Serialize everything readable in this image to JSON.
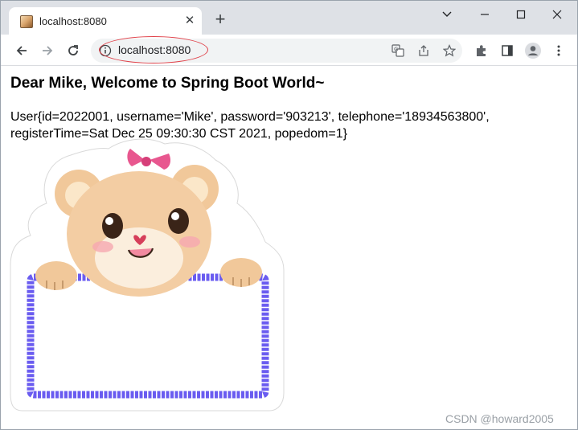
{
  "tab": {
    "title": "localhost:8080",
    "close_label": "✕",
    "new_tab_label": "+"
  },
  "omnibox": {
    "url": "localhost:8080",
    "highlight_color": "#e0424a"
  },
  "page": {
    "greeting": "Dear Mike, Welcome to Spring Boot World~",
    "user_info": "User{id=2022001, username='Mike', password='903213', telephone='18934563800', registerTime=Sat Dec 25 09:30:30 CST 2021, popedom=1}"
  },
  "watermark": "CSDN @howard2005",
  "icons": {
    "favicon": "bear-favicon",
    "back": "back-arrow-icon",
    "forward": "forward-arrow-icon",
    "reload": "reload-icon",
    "info": "info-icon",
    "translate": "translate-icon",
    "share": "share-icon",
    "bookmark": "star-icon",
    "extensions": "puzzle-icon",
    "side_panel": "side-panel-icon",
    "profile": "profile-icon",
    "menu": "kebab-menu-icon"
  },
  "colors": {
    "frame": "#dee1e6",
    "omnibox_bg": "#f1f3f4",
    "board_border": "#6a5cf0",
    "bow": "#e8578f"
  }
}
